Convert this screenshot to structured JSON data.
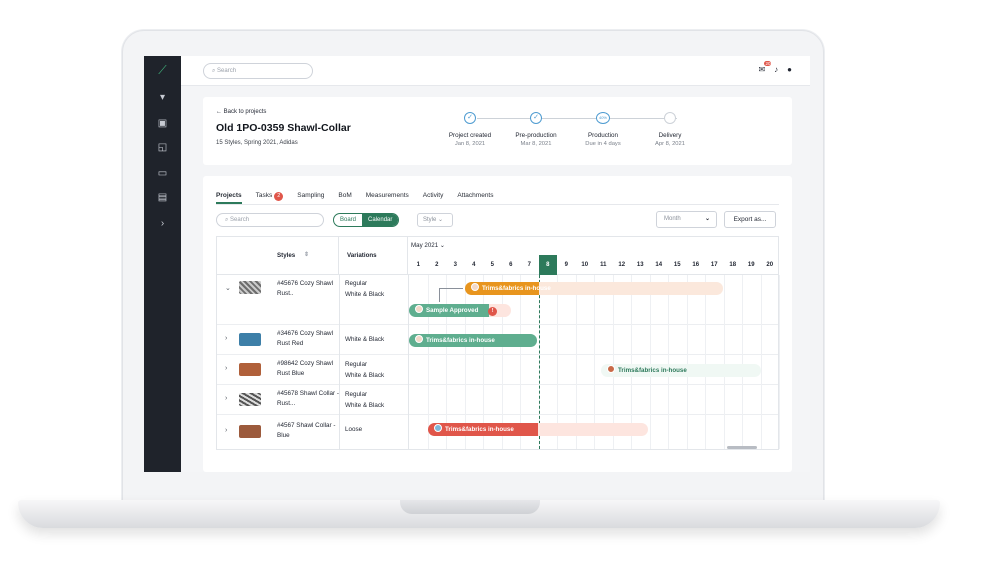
{
  "topbar": {
    "search_placeholder": "Search",
    "notification_count": "20"
  },
  "project": {
    "back_label": "Back to projects",
    "title": "Old 1PO-0359 Shawl-Collar",
    "subtitle": "15 Styles, Spring 2021, Adidas",
    "steps": [
      {
        "label": "Project created",
        "sub": "Jan 8, 2021",
        "mark": "✓"
      },
      {
        "label": "Pre-production",
        "sub": "Mar 8, 2021",
        "mark": "✓"
      },
      {
        "label": "Production",
        "sub": "Due in 4 days",
        "mark": "40%"
      },
      {
        "label": "Delivery",
        "sub": "Apr 8, 2021",
        "mark": ""
      }
    ]
  },
  "tabs": [
    {
      "label": "Projects"
    },
    {
      "label": "Tasks",
      "badge": "2"
    },
    {
      "label": "Sampling"
    },
    {
      "label": "BoM"
    },
    {
      "label": "Measurements"
    },
    {
      "label": "Activity"
    },
    {
      "label": "Attachments"
    }
  ],
  "toolbar": {
    "search_placeholder": "Search",
    "view_board": "Board",
    "view_calendar": "Calendar",
    "style_filter": "Style",
    "month_select": "Month",
    "export_label": "Export as..."
  },
  "grid": {
    "col_styles": "Styles",
    "col_variations": "Variations",
    "month_label": "May 2021",
    "days": [
      "1",
      "2",
      "3",
      "4",
      "5",
      "6",
      "7",
      "8",
      "9",
      "10",
      "11",
      "12",
      "13",
      "14",
      "15",
      "16",
      "17",
      "18",
      "19",
      "20"
    ],
    "today_day": "8"
  },
  "rows": [
    {
      "style": "#45676 Cozy Shawl Rust..",
      "variations": [
        "Regular",
        "White & Black"
      ],
      "expanded": true
    },
    {
      "style": "#34676 Cozy Shawl Rust Red",
      "variations": [
        "White & Black"
      ]
    },
    {
      "style": "#98642 Cozy Shawl Rust Blue",
      "variations": [
        "Regular",
        "White & Black"
      ]
    },
    {
      "style": "#45678 Shawl Collar - Rust...",
      "variations": [
        "Regular",
        "White & Black"
      ]
    },
    {
      "style": "#4567 Shawl Collar -Blue",
      "variations": [
        "Loose"
      ]
    }
  ],
  "bars": {
    "b1": "Trims&fabrics in-house",
    "b2": "Sample Approved",
    "b2_badge": "!",
    "b3": "Trims&fabrics in-house",
    "b4": "Trims&fabrics in-house",
    "b5": "Trims&fabrics in-house"
  },
  "colors": {
    "primary": "#2d7a5b",
    "orange": "#e8951e",
    "red": "#e0564a",
    "teal": "#5fae8f"
  }
}
